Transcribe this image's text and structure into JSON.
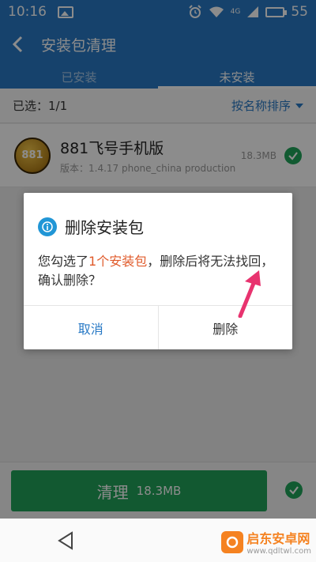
{
  "status_bar": {
    "time": "10:16",
    "network": "4G",
    "battery": "55"
  },
  "header": {
    "title": "安装包清理"
  },
  "tabs": [
    {
      "label": "已安装",
      "active": false
    },
    {
      "label": "未安装",
      "active": true
    }
  ],
  "selection": {
    "count_text": "已选：1/1",
    "sort_label": "按名称排序"
  },
  "app_item": {
    "icon_text": "881",
    "name": "881飞号手机版",
    "version": "版本：1.4.17 phone_china production",
    "size": "18.3MB",
    "checked": true
  },
  "action_bar": {
    "clean_label": "清理",
    "clean_size": "18.3MB"
  },
  "dialog": {
    "title": "删除安装包",
    "message_prefix": "您勾选了",
    "message_highlight": "1个安装包",
    "message_suffix": "，删除后将无法找回，确认删除？",
    "cancel_label": "取消",
    "confirm_label": "删除"
  },
  "watermark": {
    "title": "启东安卓网",
    "url": "www.qdltwl.com"
  },
  "colors": {
    "primary": "#2879c5",
    "green": "#22a35a",
    "highlight": "#e05a2a",
    "arrow": "#e8336f"
  }
}
